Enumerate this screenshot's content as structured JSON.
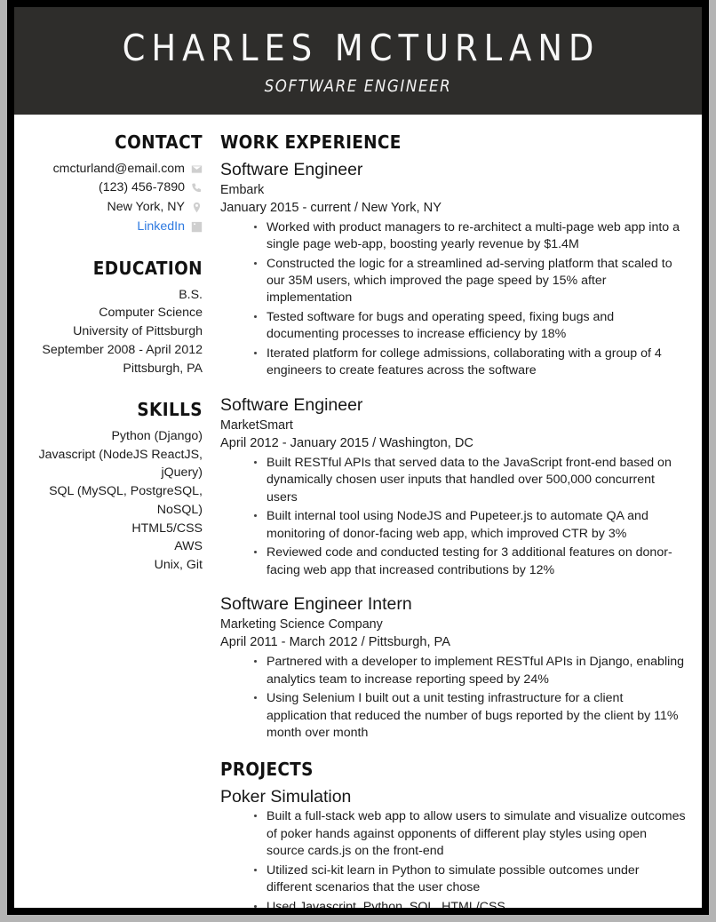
{
  "header": {
    "name": "CHARLES MCTURLAND",
    "title": "SOFTWARE ENGINEER",
    "background_color": "#2e2d2b",
    "text_color": "#ffffff"
  },
  "sidebar": {
    "contact": {
      "heading": "CONTACT",
      "items": [
        {
          "text": "cmcturland@email.com",
          "icon": "envelope-icon",
          "is_link": false
        },
        {
          "text": "(123) 456-7890",
          "icon": "phone-icon",
          "is_link": false
        },
        {
          "text": "New York, NY",
          "icon": "location-pin-icon",
          "is_link": false
        },
        {
          "text": "LinkedIn",
          "icon": "linkedin-icon",
          "is_link": true
        }
      ],
      "link_color": "#2d79e0",
      "icon_color": "#cfcfcf"
    },
    "education": {
      "heading": "EDUCATION",
      "lines": [
        "B.S.",
        "Computer Science",
        "University of Pittsburgh",
        "September 2008 - April 2012",
        "Pittsburgh, PA"
      ]
    },
    "skills": {
      "heading": "SKILLS",
      "items": [
        "Python (Django)",
        "Javascript (NodeJS ReactJS, jQuery)",
        "SQL (MySQL, PostgreSQL, NoSQL)",
        "HTML5/CSS",
        "AWS",
        "Unix, Git"
      ]
    }
  },
  "main": {
    "work": {
      "heading": "WORK EXPERIENCE",
      "entries": [
        {
          "title": "Software Engineer",
          "company": "Embark",
          "dates": "January 2015 - current",
          "separator": "/",
          "location": "New York, NY",
          "bullets": [
            "Worked with product managers to re-architect a multi-page web app into a single page web-app, boosting yearly revenue by $1.4M",
            "Constructed the logic for a streamlined ad-serving platform that scaled to our 35M users, which improved the page speed by 15% after implementation",
            "Tested software for bugs and operating speed, fixing bugs and documenting processes to increase efficiency by 18%",
            "Iterated platform for college admissions, collaborating with a group of 4 engineers to create features across the software"
          ]
        },
        {
          "title": "Software Engineer",
          "company": "MarketSmart",
          "dates": "April 2012 - January 2015",
          "separator": "/",
          "location": "Washington, DC",
          "bullets": [
            "Built RESTful APIs that served data to the JavaScript front-end based on dynamically chosen user inputs that handled over 500,000 concurrent users",
            "Built internal tool using NodeJS and Pupeteer.js to automate QA and monitoring of donor-facing web app, which improved CTR by 3%",
            "Reviewed code and conducted testing for 3 additional features on donor-facing web app that increased contributions by 12%"
          ]
        },
        {
          "title": "Software Engineer Intern",
          "company": "Marketing Science Company",
          "dates": "April 2011 - March 2012",
          "separator": "/",
          "location": "Pittsburgh, PA",
          "bullets": [
            "Partnered with a developer to implement RESTful APIs in Django, enabling analytics team to increase reporting speed by 24%",
            "Using Selenium I built out a unit testing infrastructure for a client application that reduced the number of bugs reported by the client by 11% month over month"
          ]
        }
      ]
    },
    "projects": {
      "heading": "PROJECTS",
      "entries": [
        {
          "title": "Poker Simulation",
          "bullets": [
            "Built a full-stack web app to allow users to simulate and visualize outcomes of poker hands against opponents of different play styles using open source cards.js on the front-end",
            "Utilized sci-kit learn in Python to simulate possible outcomes under different scenarios that the user chose",
            "Used Javascript, Python, SQL, HTML/CSS"
          ]
        }
      ]
    }
  }
}
